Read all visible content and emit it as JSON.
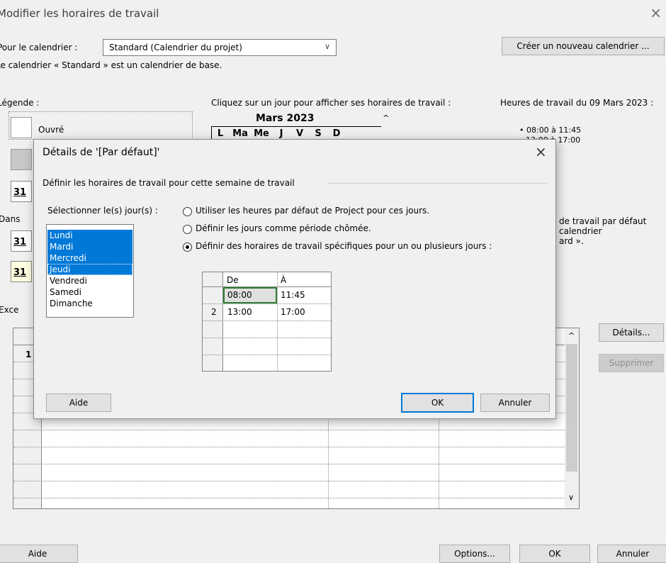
{
  "window": {
    "title": "Modifier les horaires de travail",
    "close_glyph": "×"
  },
  "calendar_select": {
    "label": "Pour le calendrier :",
    "value": "Standard (Calendrier du projet)"
  },
  "new_calendar_button": "Créer un nouveau calendrier ...",
  "base_calendar_note": "Le calendrier « Standard » est un calendrier de base.",
  "legend": {
    "title": "Légende :",
    "working_label": "Ouvré",
    "day_number": "31",
    "in_prefix": "Dans"
  },
  "calendar": {
    "instruction": "Cliquez sur un jour pour afficher ses horaires de travail :",
    "month": "Mars 2023",
    "weekdays": [
      "L",
      "Ma",
      "Me",
      "J",
      "V",
      "S",
      "D"
    ]
  },
  "hours_panel": {
    "title": "Heures de travail du 09 Mars 2023 :",
    "lines": [
      "• 08:00 à 11:45",
      "13:00 à 17:00"
    ],
    "note_lines": [
      "de travail par défaut",
      "calendrier",
      "ard »."
    ]
  },
  "exceptions": {
    "tab_prefix": "Exce",
    "row_number": "1",
    "details_button": "Détails...",
    "delete_button": "Supprimer"
  },
  "footer": {
    "help_button": "Aide",
    "options_button": "Options...",
    "ok_button": "OK",
    "cancel_button": "Annuler"
  },
  "details_dialog": {
    "title": "Détails de '[Par défaut]'",
    "close_glyph": "×",
    "group_label": "Définir les horaires de travail pour cette semaine de travail",
    "days_label": "Sélectionner le(s) jour(s) :",
    "days": [
      {
        "name": "Lundi",
        "selected": true
      },
      {
        "name": "Mardi",
        "selected": true
      },
      {
        "name": "Mercredi",
        "selected": true
      },
      {
        "name": "Jeudi",
        "selected": true
      },
      {
        "name": "Vendredi",
        "selected": false
      },
      {
        "name": "Samedi",
        "selected": false
      },
      {
        "name": "Dimanche",
        "selected": false
      }
    ],
    "options": [
      {
        "label": "Utiliser les heures par défaut de Project pour ces jours.",
        "checked": false
      },
      {
        "label": "Définir les jours comme période chômée.",
        "checked": false
      },
      {
        "label": "Définir des horaires de travail spécifiques pour un ou plusieurs jours :",
        "checked": true
      }
    ],
    "table": {
      "headers": [
        "De",
        "À"
      ],
      "rows": [
        {
          "num": "",
          "from": "08:00",
          "to": "11:45"
        },
        {
          "num": "2",
          "from": "13:00",
          "to": "17:00"
        },
        {
          "num": "",
          "from": "",
          "to": ""
        },
        {
          "num": "",
          "from": "",
          "to": ""
        },
        {
          "num": "",
          "from": "",
          "to": ""
        }
      ]
    },
    "help_button": "Aide",
    "ok_button": "OK",
    "cancel_button": "Annuler"
  },
  "colors": {
    "selection": "#0078d7",
    "dialog_bg": "#f0f0f0"
  }
}
